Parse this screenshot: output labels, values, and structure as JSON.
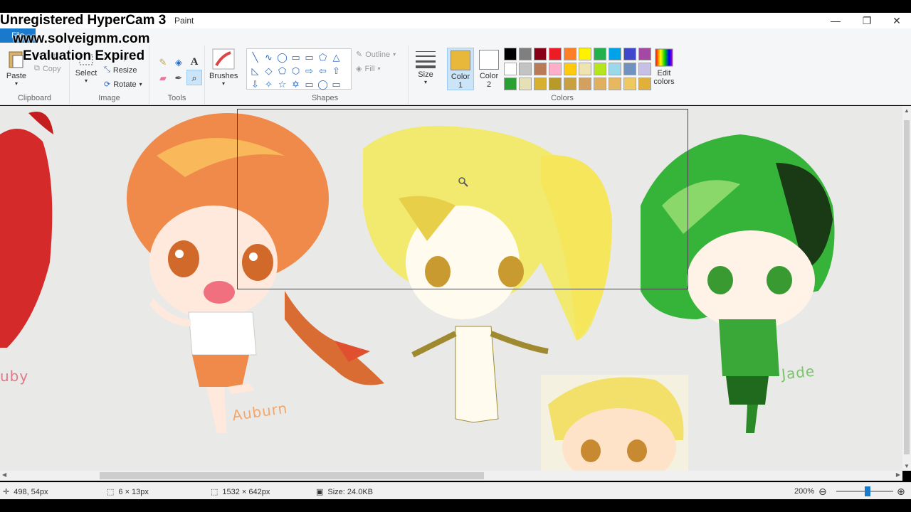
{
  "window": {
    "title": "Paint",
    "minimize": "—",
    "restore": "❐",
    "close": "✕"
  },
  "ribbon": {
    "file_tab": "File",
    "clipboard": {
      "paste": "Paste",
      "cut": "Cut",
      "copy": "Copy",
      "label": "Clipboard"
    },
    "image": {
      "select": "Select",
      "crop": "Crop",
      "resize": "Resize",
      "rotate": "Rotate",
      "label": "Image"
    },
    "tools": {
      "label": "Tools"
    },
    "brushes": {
      "label": "Brushes"
    },
    "shapes": {
      "label": "Shapes",
      "outline": "Outline",
      "fill": "Fill",
      "items": [
        "╲",
        "∿",
        "◯",
        "▭",
        "▭",
        "⬠",
        "△",
        "◺",
        "◇",
        "⬠",
        "⬡",
        "⇨",
        "⇦",
        "⇧",
        "⇩",
        "✧",
        "☆",
        "✡",
        "▭",
        "◯",
        "▭"
      ]
    },
    "size": {
      "label": "Size"
    },
    "colors": {
      "color1_label": "Color",
      "color1_num": "1",
      "color2_label": "Color",
      "color2_num": "2",
      "edit_label": "Edit",
      "edit_label2": "colors",
      "label": "Colors",
      "color1": "#e8b83a",
      "color2": "#ffffff",
      "palette": [
        "#000000",
        "#7f7f7f",
        "#880015",
        "#ed1c24",
        "#ff7f27",
        "#fff200",
        "#22b14c",
        "#00a2e8",
        "#3f48cc",
        "#a349a4",
        "#ffffff",
        "#c3c3c3",
        "#b97a57",
        "#ffaec9",
        "#ffc90e",
        "#efe4b0",
        "#b5e61d",
        "#99d9ea",
        "#7092be",
        "#c8bfe7",
        "#2aa034",
        "#e6e0b6",
        "#d8b030",
        "#b89a28",
        "#c8a040",
        "#d4a060",
        "#e0b060",
        "#e8b860",
        "#f0c860",
        "#e0b038"
      ]
    }
  },
  "watermark": {
    "line1": "Unregistered HyperCam 3",
    "line2": "www.solveigmm.com",
    "line3": "Evaluation Expired"
  },
  "canvas": {
    "signatures": {
      "ruby": "uby",
      "auburn": "Auburn",
      "jade": "Jade"
    }
  },
  "status": {
    "cursor_pos": "498, 54px",
    "selection_size": "6 × 13px",
    "image_size": "1532 × 642px",
    "file_size": "Size: 24.0KB",
    "zoom": "200%",
    "zoom_out": "⊖",
    "zoom_in": "⊕"
  }
}
